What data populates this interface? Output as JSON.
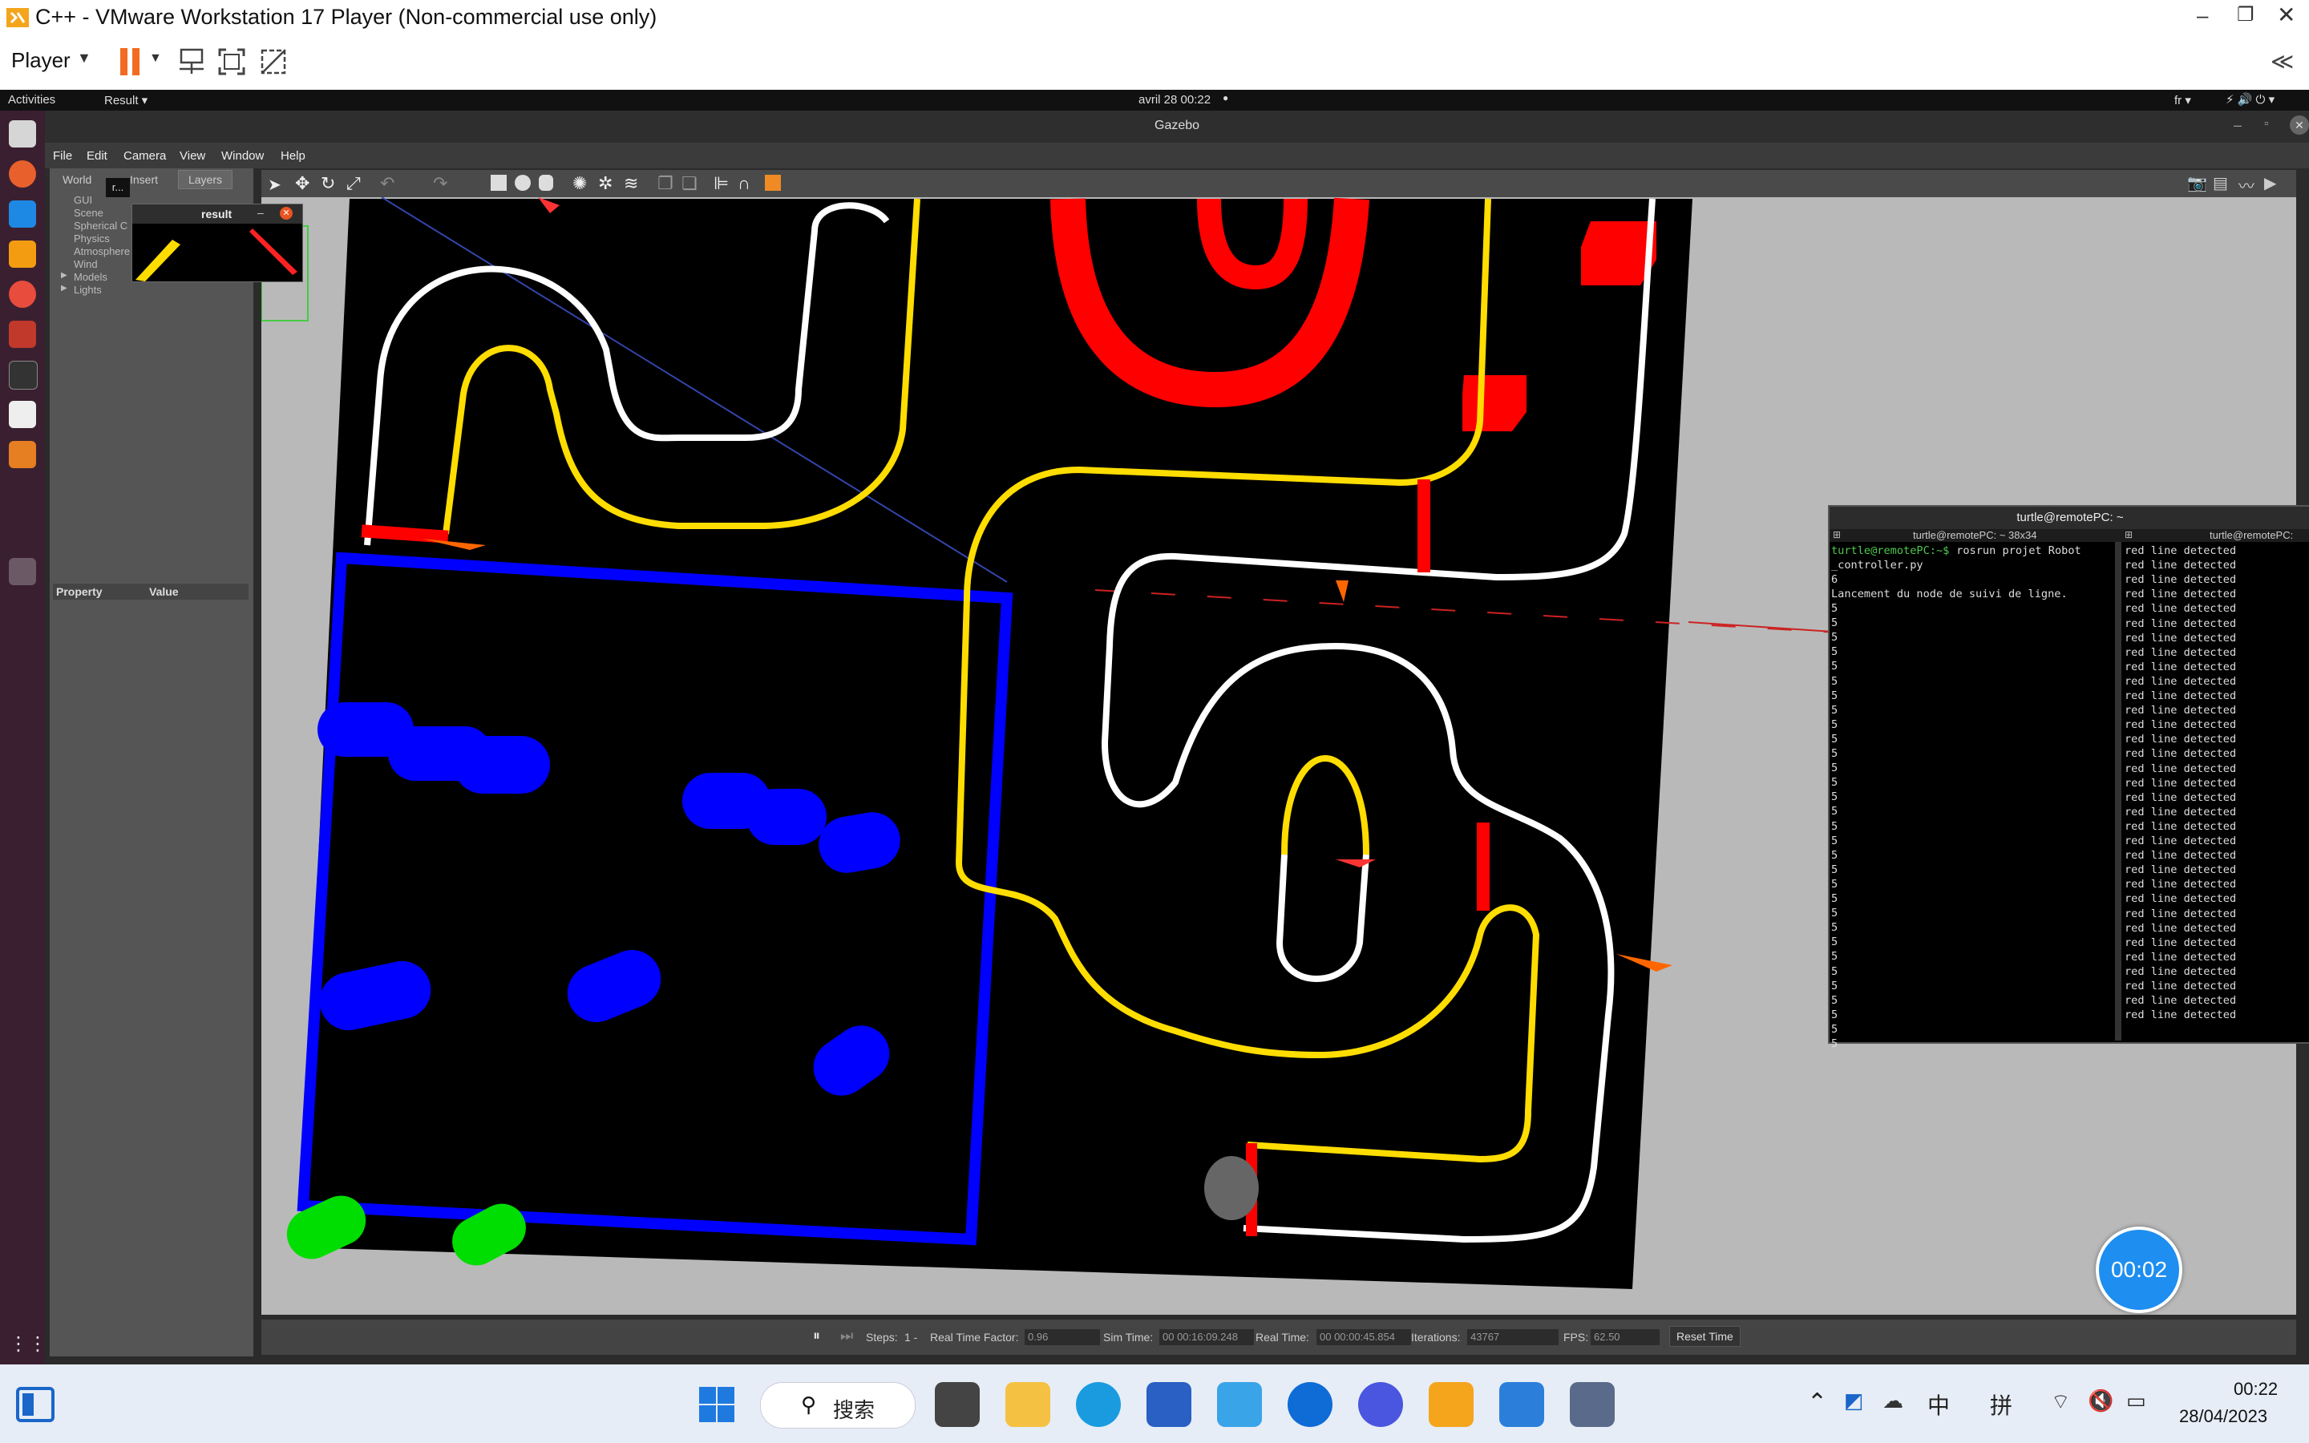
{
  "window": {
    "title": "C++ - VMware Workstation 17 Player (Non-commercial use only)",
    "player_label": "Player",
    "collapse_glyph": "≪"
  },
  "ubuntu_bar": {
    "activities": "Activities",
    "app_menu": "Result ▾",
    "datetime": "avril 28  00:22",
    "lang": "fr ▾"
  },
  "gazebo": {
    "title": "Gazebo",
    "menu": [
      "File",
      "Edit",
      "Camera",
      "View",
      "Window",
      "Help"
    ],
    "tabs": [
      "World",
      "Insert",
      "Layers"
    ],
    "world_tree": [
      "GUI",
      "Scene",
      "Spherical C",
      "Physics",
      "Atmosphere",
      "Wind",
      "Models",
      "Lights"
    ],
    "property_header": "Property",
    "value_header": "Value",
    "status": {
      "steps_label": "Steps:",
      "steps_value": "1 -",
      "rtf_label": "Real Time Factor:",
      "rtf_value": "0.96",
      "sim_label": "Sim Time:",
      "sim_value": "00 00:16:09.248",
      "real_label": "Real Time:",
      "real_value": "00 00:00:45.854",
      "iter_label": "Iterations:",
      "iter_value": "43767",
      "fps_label": "FPS:",
      "fps_value": "62.50",
      "reset_label": "Reset Time"
    }
  },
  "result_popup": {
    "title": "result",
    "partial_label": "r..."
  },
  "terminal": {
    "title": "turtle@remotePC: ~",
    "left_tab": "turtle@remotePC: ~ 38x34",
    "right_tab": "turtle@remotePC:",
    "prompt": "turtle@remotePC:~$",
    "command": " rosrun projet Robot",
    "command_cont": "_controller.py",
    "out1": "6",
    "out2": "Lancement du node de suivi de ligne.",
    "fives": [
      "5",
      "5",
      "5",
      "5",
      "5",
      "5",
      "5",
      "5",
      "5",
      "5",
      "5",
      "5",
      "5",
      "5",
      "5",
      "5",
      "5",
      "5",
      "5",
      "5",
      "5",
      "5",
      "5",
      "5",
      "5",
      "5",
      "5",
      "5",
      "5",
      "5",
      "5"
    ],
    "detections": [
      "red line detected",
      "red line detected",
      "red line detected",
      "red line detected",
      "red line detected",
      "red line detected",
      "red line detected",
      "red line detected",
      "red line detected",
      "red line detected",
      "red line detected",
      "red line detected",
      "red line detected",
      "red line detected",
      "red line detected",
      "red line detected",
      "red line detected",
      "red line detected",
      "red line detected",
      "red line detected",
      "red line detected",
      "red line detected",
      "red line detected",
      "red line detected",
      "red line detected",
      "red line detected",
      "red line detected",
      "red line detected",
      "red line detected",
      "red line detected",
      "red line detected",
      "red line detected",
      "red line detected"
    ]
  },
  "timer": "00:02",
  "taskbar": {
    "search_label": "搜索",
    "ime1": "中",
    "ime2": "拼",
    "time": "00:22",
    "date": "28/04/2023"
  },
  "colors": {
    "yellow_track": "#ffdd00",
    "red_obstacle": "#ff0000",
    "blue_zone": "#0000ff",
    "green_obstacle": "#00dd00",
    "terminal_green": "#4ec94e"
  }
}
